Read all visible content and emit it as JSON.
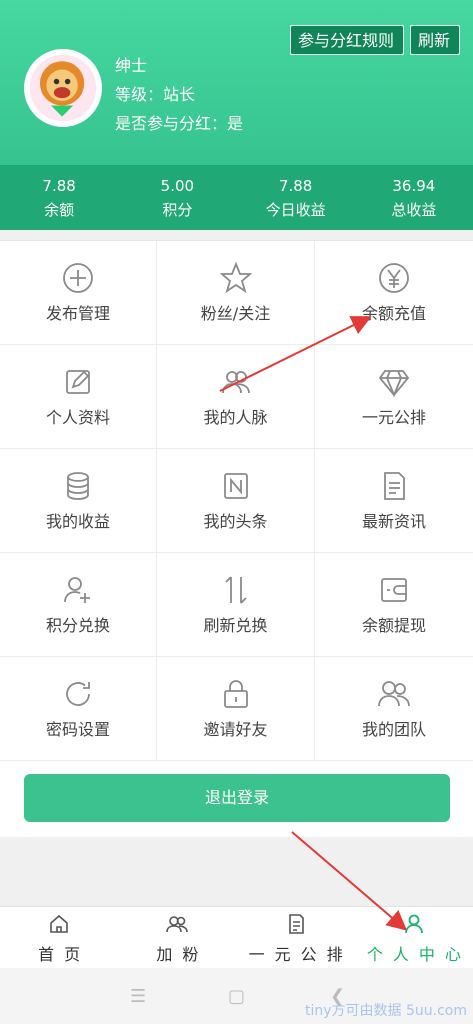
{
  "header": {
    "rules_button": "参与分红规则",
    "refresh_button": "刷新",
    "user": {
      "name": "绅士",
      "level": "等级：站长",
      "dividend": "是否参与分红：是"
    }
  },
  "stats": [
    {
      "value": "7.88",
      "label": "余额"
    },
    {
      "value": "5.00",
      "label": "积分"
    },
    {
      "value": "7.88",
      "label": "今日收益"
    },
    {
      "value": "36.94",
      "label": "总收益"
    }
  ],
  "grid": [
    {
      "label": "发布管理",
      "icon": "plus-circle-icon"
    },
    {
      "label": "粉丝/关注",
      "icon": "star-icon"
    },
    {
      "label": "余额充值",
      "icon": "yen-icon"
    },
    {
      "label": "个人资料",
      "icon": "edit-icon"
    },
    {
      "label": "我的人脉",
      "icon": "people-icon"
    },
    {
      "label": "一元公排",
      "icon": "diamond-icon"
    },
    {
      "label": "我的收益",
      "icon": "coins-icon"
    },
    {
      "label": "我的头条",
      "icon": "news-icon"
    },
    {
      "label": "最新资讯",
      "icon": "document-icon"
    },
    {
      "label": "积分兑换",
      "icon": "user-plus-icon"
    },
    {
      "label": "刷新兑换",
      "icon": "swap-icon"
    },
    {
      "label": "余额提现",
      "icon": "wallet-icon"
    },
    {
      "label": "密码设置",
      "icon": "refresh-icon"
    },
    {
      "label": "邀请好友",
      "icon": "lock-icon"
    },
    {
      "label": "我的团队",
      "icon": "team-icon"
    }
  ],
  "logout_button": "退出登录",
  "tabs": [
    {
      "label": "首页",
      "icon": "home-icon"
    },
    {
      "label": "加粉",
      "icon": "fans-icon"
    },
    {
      "label": "一元公排",
      "icon": "list-icon"
    },
    {
      "label": "个人中心",
      "icon": "user-icon",
      "active": true
    }
  ],
  "watermark": "tiny方可由数据 5uu.com",
  "colors": {
    "accent": "#3bc28f",
    "header": "#36c391",
    "dark_green": "#10855a",
    "arrow": "#e53935"
  }
}
